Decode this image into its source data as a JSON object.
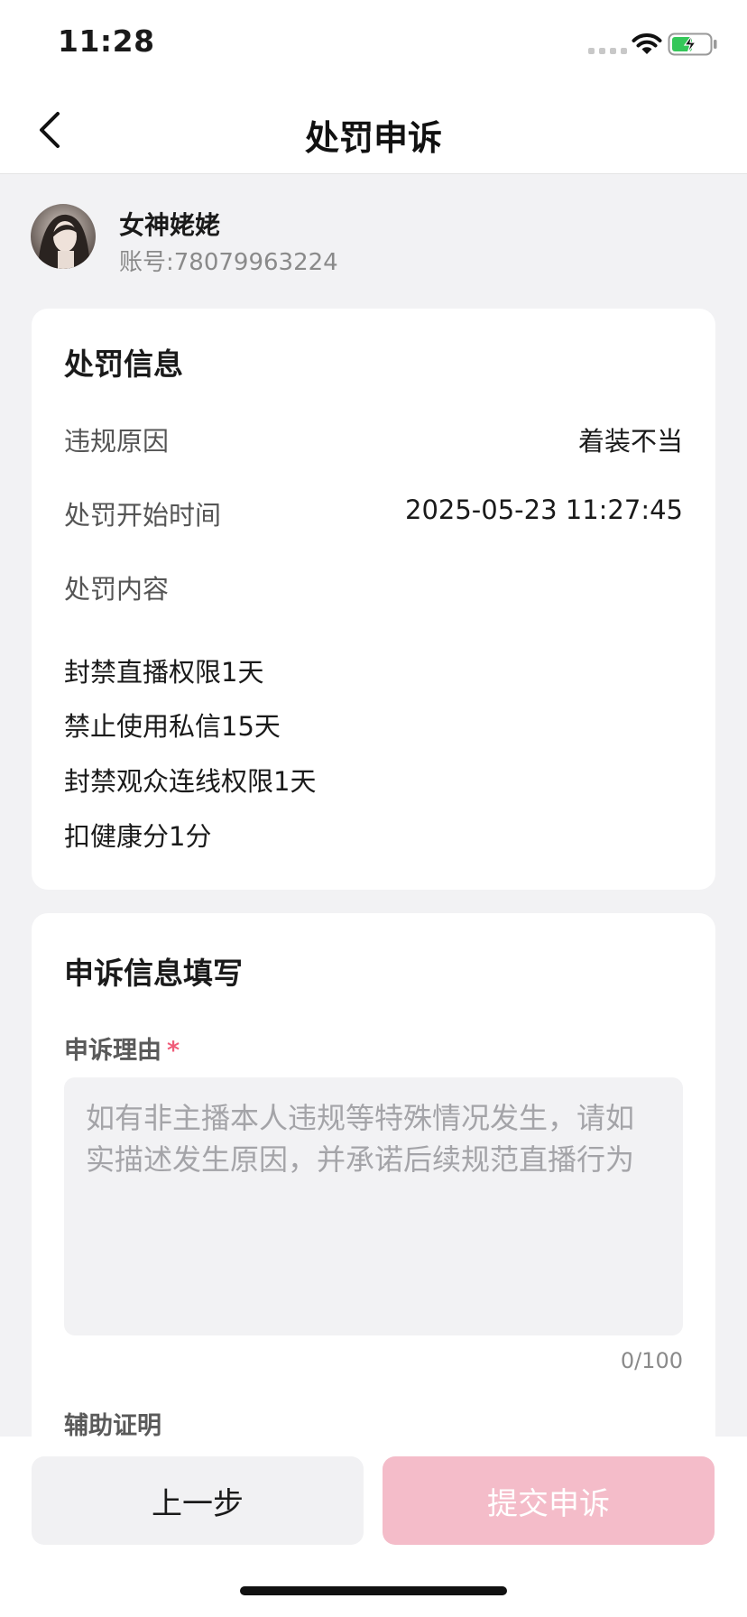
{
  "status_bar": {
    "time": "11:28",
    "icons": [
      "signal-icon",
      "wifi-icon",
      "battery-charging-icon"
    ]
  },
  "nav": {
    "title": "处罚申诉",
    "back_icon": "chevron-left-icon"
  },
  "profile": {
    "name": "女神姥姥",
    "account": "账号:78079963224"
  },
  "punishment": {
    "title": "处罚信息",
    "reason_label": "违规原因",
    "reason_value": "着装不当",
    "start_label": "处罚开始时间",
    "start_value": "2025-05-23 11:27:45",
    "content_label": "处罚内容",
    "items": [
      "封禁直播权限1天",
      "禁止使用私信15天",
      "封禁观众连线权限1天",
      "扣健康分1分"
    ]
  },
  "appeal": {
    "title": "申诉信息填写",
    "reason_label": "申诉理由",
    "required_mark": "*",
    "reason_placeholder": "如有非主播本人违规等特殊情况发生，请如实描述发生原因，并承诺后续规范直播行为",
    "reason_value": "",
    "char_count": "0/100",
    "evidence_label": "辅助证明"
  },
  "actions": {
    "prev_label": "上一步",
    "submit_label": "提交申诉"
  },
  "colors": {
    "accent_pink": "#f4bcc9",
    "required_star": "#f05d7a",
    "page_bg": "#f2f2f4"
  }
}
